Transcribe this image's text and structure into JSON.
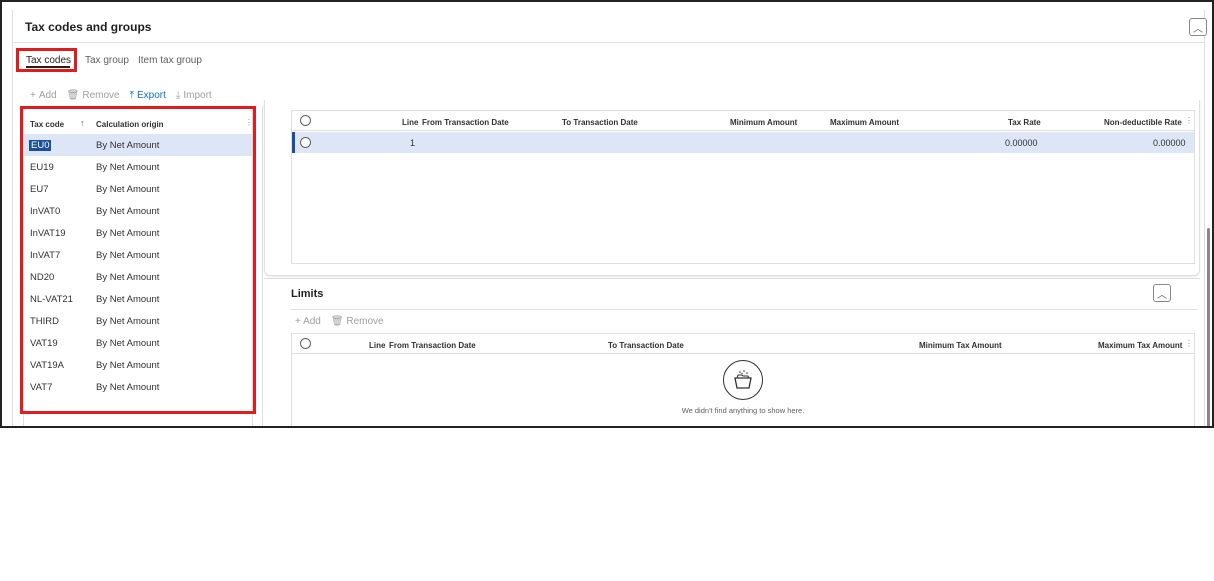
{
  "section": {
    "title": "Tax codes and groups"
  },
  "tabs": [
    {
      "label": "Tax codes"
    },
    {
      "label": "Tax group"
    },
    {
      "label": "Item tax group"
    }
  ],
  "toolbar": {
    "add": "Add",
    "remove": "Remove",
    "export": "Export",
    "import": "Import"
  },
  "tax_codes_grid": {
    "columns": [
      "Tax code",
      "Calculation origin"
    ],
    "rows": [
      {
        "code": "EU0",
        "origin": "By Net Amount"
      },
      {
        "code": "EU19",
        "origin": "By Net Amount"
      },
      {
        "code": "EU7",
        "origin": "By Net Amount"
      },
      {
        "code": "InVAT0",
        "origin": "By Net Amount"
      },
      {
        "code": "InVAT19",
        "origin": "By Net Amount"
      },
      {
        "code": "InVAT7",
        "origin": "By Net Amount"
      },
      {
        "code": "ND20",
        "origin": "By Net Amount"
      },
      {
        "code": "NL-VAT21",
        "origin": "By Net Amount"
      },
      {
        "code": "THIRD",
        "origin": "By Net Amount"
      },
      {
        "code": "VAT19",
        "origin": "By Net Amount"
      },
      {
        "code": "VAT19A",
        "origin": "By Net Amount"
      },
      {
        "code": "VAT7",
        "origin": "By Net Amount"
      }
    ]
  },
  "values_grid": {
    "columns": {
      "line": "Line",
      "from": "From Transaction Date",
      "to": "To Transaction Date",
      "min": "Minimum Amount",
      "max": "Maximum Amount",
      "rate": "Tax Rate",
      "nondeduct": "Non-deductible Rate"
    },
    "rows": [
      {
        "line": "1",
        "rate": "0.00000",
        "nondeduct": "0.00000"
      }
    ]
  },
  "limits": {
    "title": "Limits",
    "add": "Add",
    "remove": "Remove",
    "columns": {
      "line": "Line",
      "from": "From Transaction Date",
      "to": "To Transaction Date",
      "min": "Minimum Tax Amount",
      "max": "Maximum Tax Amount"
    },
    "empty_text": "We didn't find anything to show here."
  },
  "colors": {
    "highlight": "#e01c1c",
    "accent": "#0f6cbd",
    "selected_row": "#dde6f7"
  }
}
